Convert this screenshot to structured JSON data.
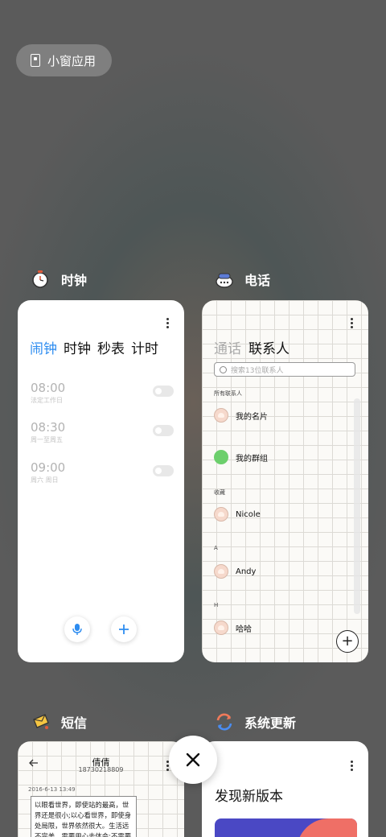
{
  "small_window": {
    "label": "小窗应用",
    "icon": "small-window-icon"
  },
  "clock_app": {
    "title": "时钟",
    "tabs": [
      "闹钟",
      "时钟",
      "秒表",
      "计时"
    ],
    "alarms": [
      {
        "time": "08:00",
        "repeat": "法定工作日"
      },
      {
        "time": "08:30",
        "repeat": "周一至周五"
      },
      {
        "time": "09:00",
        "repeat": "周六 周日"
      }
    ]
  },
  "phone_app": {
    "title": "电话",
    "tabs": [
      "通话",
      "联系人"
    ],
    "search_placeholder": "搜索13位联系人",
    "all_contacts": "所有联系人",
    "my_card": "我的名片",
    "my_groups": "我的群组",
    "favorites_header": "收藏",
    "section_a": "A",
    "section_h": "H",
    "contacts": [
      "Nicole",
      "Andy",
      "哈哈"
    ],
    "add_label": "+"
  },
  "sms_app": {
    "title": "短信",
    "contact_name": "倩倩",
    "contact_number": "18730218809",
    "date": "2016-6-13 13:49",
    "message": "以眼看世界，即使站的最高，世界还是很小;以心看世界，即使身处局限，世界依然很大。生活远不完美，需要用心去体会;不需要有太"
  },
  "update_app": {
    "title": "系统更新",
    "heading": "发现新版本"
  },
  "colors": {
    "accent": "#2d8cf0"
  }
}
